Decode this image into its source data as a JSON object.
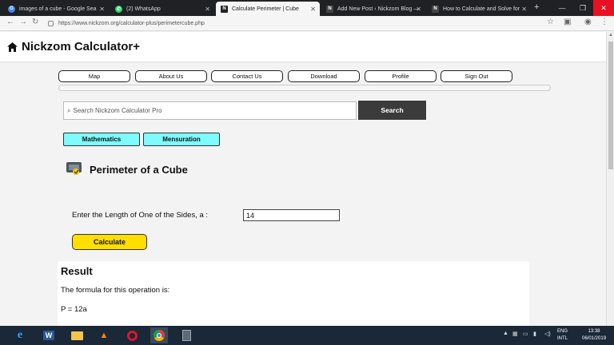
{
  "browser": {
    "tabs": [
      {
        "title": "images of a cube - Google Sea",
        "fav_color": "#4285f4",
        "fav_glyph": "G"
      },
      {
        "title": "(2) WhatsApp",
        "fav_color": "#25d366",
        "fav_glyph": "W"
      },
      {
        "title": "Calculate Perimeter | Cube",
        "fav_color": "#222222",
        "fav_glyph": "N"
      },
      {
        "title": "Add New Post ‹ Nickzom Blog —",
        "fav_color": "#222222",
        "fav_glyph": "N"
      },
      {
        "title": "How to Calculate and Solve for",
        "fav_color": "#222222",
        "fav_glyph": "N"
      }
    ],
    "url": "https://www.nickzom.org/calculator-plus/perimetercube.php"
  },
  "site": {
    "logo": "Nickzom Calculator+",
    "nav": [
      "Map",
      "About Us",
      "Contact Us",
      "Download",
      "Profile",
      "Sign Out"
    ],
    "search": {
      "placeholder": "Search Nickzom Calculator Pro",
      "button": "Search"
    },
    "categories": [
      "Mathematics",
      "Mensuration"
    ],
    "calc_title": "Perimeter of a Cube",
    "input_label": "Enter the Length of One of the Sides, a :",
    "input_value": "14",
    "calc_button": "Calculate",
    "result": {
      "heading": "Result",
      "line1": "The formula for this operation is:",
      "line2": "P = 12a"
    }
  },
  "taskbar": {
    "lang": {
      "line1": "ENG",
      "line2": "INTL"
    },
    "clock": {
      "time": "13:38",
      "date": "06/01/2019"
    }
  },
  "colors": {
    "category_bg": "#7dfbff",
    "calculate_bg": "#ffde00",
    "search_button_bg": "#3b3b3b",
    "tabstrip_bg": "#202124",
    "taskbar_bg": "#1a2838"
  }
}
